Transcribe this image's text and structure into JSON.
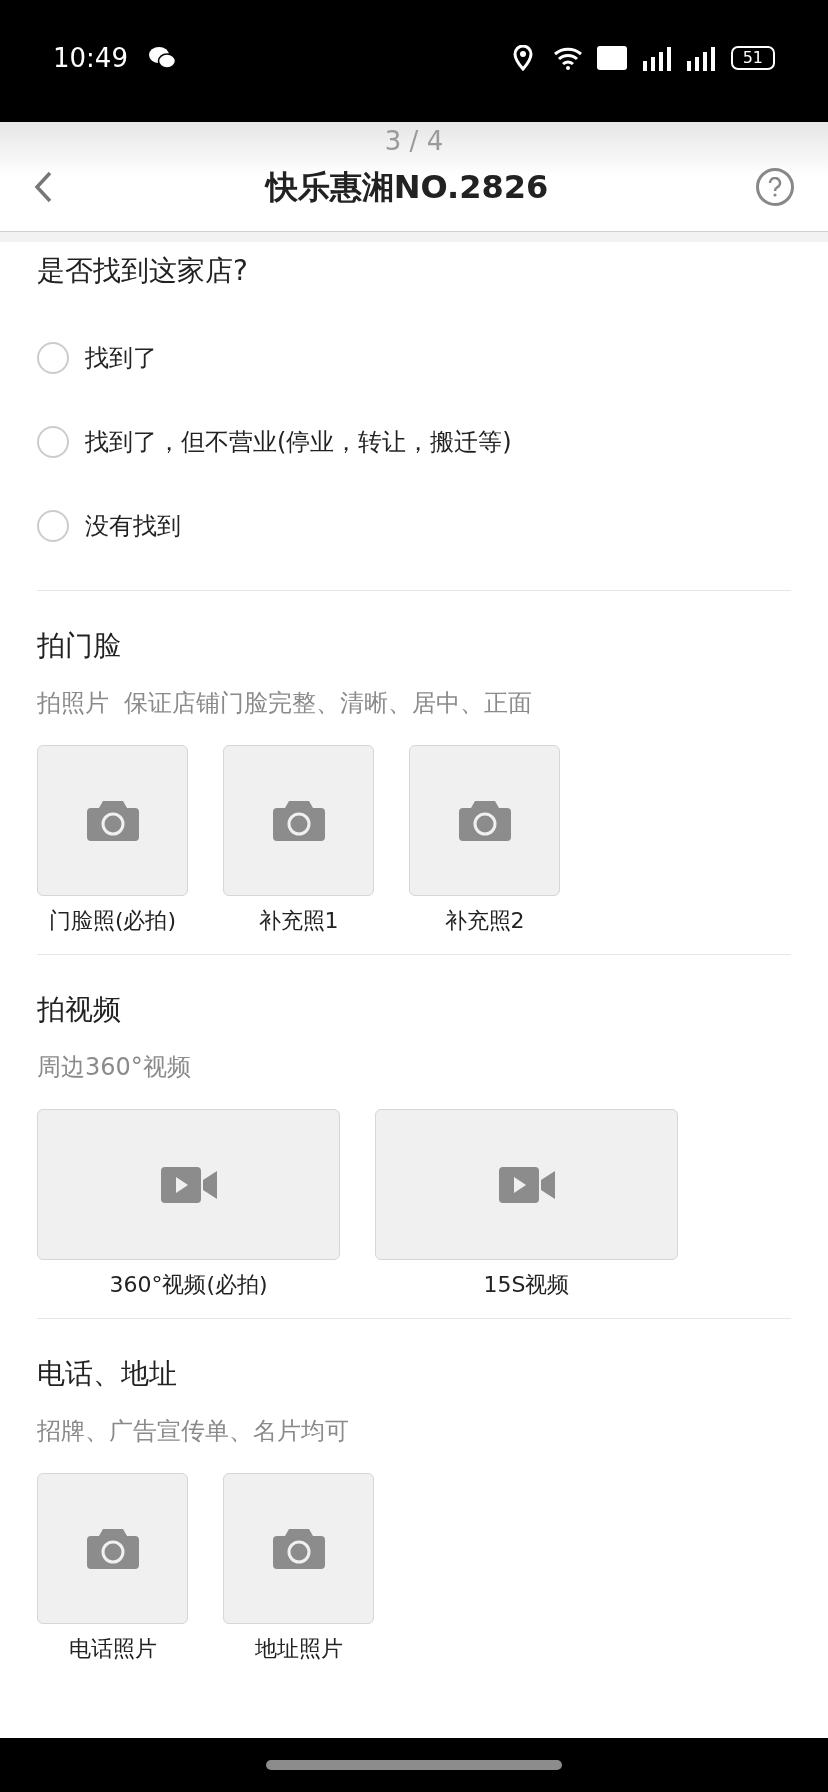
{
  "status_bar": {
    "time": "10:49",
    "battery": "51"
  },
  "header": {
    "page_indicator": "3 / 4",
    "title": "快乐惠湘NO.2826"
  },
  "question": {
    "title": "是否找到这家店?",
    "options": [
      {
        "label": "找到了",
        "selected": false
      },
      {
        "label": "找到了，但不营业(停业，转让，搬迁等)",
        "selected": false
      },
      {
        "label": "没有找到",
        "selected": false
      }
    ]
  },
  "sections": [
    {
      "title": "拍门脸",
      "subtitle": "拍照片  保证店铺门脸完整、清晰、居中、正面",
      "slots": [
        {
          "kind": "photo",
          "label": "门脸照(必拍)"
        },
        {
          "kind": "photo",
          "label": "补充照1"
        },
        {
          "kind": "photo",
          "label": "补充照2"
        }
      ]
    },
    {
      "title": "拍视频",
      "subtitle": "周边360°视频",
      "slots": [
        {
          "kind": "video",
          "label": "360°视频(必拍)"
        },
        {
          "kind": "video",
          "label": "15S视频"
        }
      ]
    },
    {
      "title": "电话、地址",
      "subtitle": "招牌、广告宣传单、名片均可",
      "slots": [
        {
          "kind": "photo",
          "label": "电话照片"
        },
        {
          "kind": "photo",
          "label": "地址照片"
        }
      ]
    }
  ]
}
